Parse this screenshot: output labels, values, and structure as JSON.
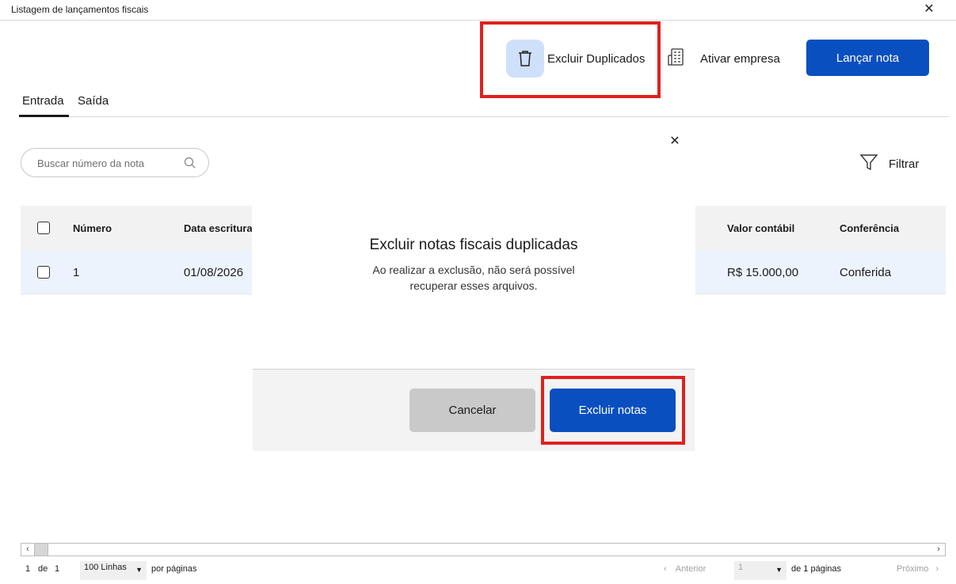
{
  "window": {
    "title": "Listagem de lançamentos fiscais",
    "close_symbol": "✕"
  },
  "toolbar": {
    "delete_duplicates_label": "Excluir Duplicados",
    "activate_company_label": "Ativar empresa",
    "launch_note_label": "Lançar nota"
  },
  "tabs": [
    {
      "label": "Entrada",
      "active": true
    },
    {
      "label": "Saída",
      "active": false
    }
  ],
  "search": {
    "placeholder": "Buscar número da nota"
  },
  "filter": {
    "label": "Filtrar"
  },
  "table": {
    "headers": {
      "number": "Número",
      "date": "Data escritura",
      "value": "Valor contábil",
      "check": "Conferência"
    },
    "rows": [
      {
        "number": "1",
        "date": "01/08/2026",
        "value": "R$ 15.000,00",
        "check": "Conferida"
      }
    ]
  },
  "modal": {
    "close_symbol": "✕",
    "title": "Excluir notas fiscais duplicadas",
    "message": "Ao realizar a exclusão, não será possível recuperar esses arquivos.",
    "cancel_label": "Cancelar",
    "confirm_label": "Excluir notas"
  },
  "pagination": {
    "current": "1",
    "of_label": "de",
    "total": "1",
    "rows_option": "100 Linhas",
    "per_page_label": "por páginas",
    "prev_label": "Anterior",
    "page_value": "1",
    "pages_label": "de 1 páginas",
    "next_label": "Próximo"
  },
  "colors": {
    "primary": "#0a4fbf",
    "highlight": "#e0201e",
    "icon_bg": "#cfe0fa",
    "row_selected": "#ecf3fd"
  }
}
